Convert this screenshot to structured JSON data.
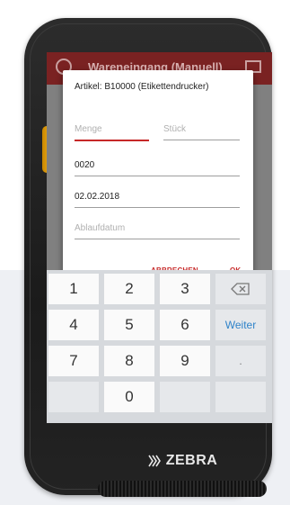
{
  "app": {
    "title": "Wareneingang (Manuell)"
  },
  "dialog": {
    "title": "Artikel: B10000 (Etikettendrucker)",
    "fields": {
      "menge_placeholder": "Menge",
      "stueck_placeholder": "Stück",
      "quantity_value": "0020",
      "date_value": "02.02.2018",
      "ablauf_placeholder": "Ablaufdatum"
    },
    "buttons": {
      "cancel": "ABBRECHEN",
      "ok": "OK"
    }
  },
  "keyboard": {
    "keys": [
      "1",
      "2",
      "3",
      "4",
      "5",
      "6",
      "Weiter",
      "7",
      "8",
      "9",
      ".",
      "0"
    ],
    "backspace_icon": "backspace-icon",
    "accent_color": "#2f83c9"
  },
  "device": {
    "brand": "ZEBRA"
  },
  "colors": {
    "accent": "#c62828",
    "appbar": "#7a2222"
  }
}
